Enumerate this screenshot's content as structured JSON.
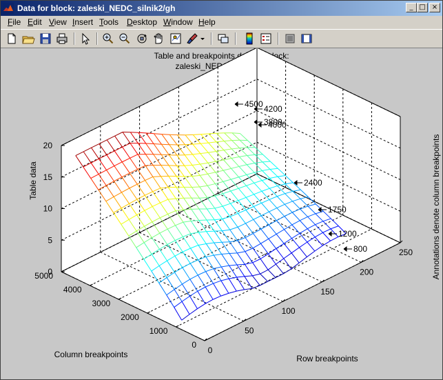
{
  "window": {
    "title": "Data for block: zaleski_NEDC_silnik2/gh",
    "colors": {
      "title_start": "#0a246a",
      "title_end": "#a6caf0",
      "figure_bg": "#c8c8c8"
    }
  },
  "window_buttons": {
    "minimize": "_",
    "maximize": "□",
    "close": "×"
  },
  "menu": [
    "File",
    "Edit",
    "View",
    "Insert",
    "Tools",
    "Desktop",
    "Window",
    "Help"
  ],
  "toolbar": {
    "icons": [
      "new-figure-icon",
      "open-file-icon",
      "save-icon",
      "print-icon",
      "edit-plot-arrow-icon",
      "zoom-in-icon",
      "zoom-out-icon",
      "rotate-3d-icon",
      "pan-icon",
      "data-cursor-icon",
      "brush-icon",
      "brush-dropdown-icon",
      "link-plot-icon",
      "colorbar-icon",
      "legend-icon",
      "hide-plot-tools-icon",
      "show-plot-tools-icon"
    ]
  },
  "plot": {
    "title_line1": "Table and breakpoints data for block:",
    "title_line2": "zaleski_NEDC_silnik2/gh",
    "right_label": "Annotations denote column breakpoints"
  },
  "chart_data": {
    "type": "surface",
    "title": "Table and breakpoints data for block: zaleski_NEDC_silnik2/gh",
    "xlabel": "Row breakpoints",
    "ylabel": "Column breakpoints",
    "zlabel": "Table data",
    "xlim": [
      0,
      250
    ],
    "ylim": [
      0,
      5000
    ],
    "zlim": [
      0,
      20
    ],
    "x_ticks": [
      "0",
      "50",
      "100",
      "150",
      "200",
      "250"
    ],
    "y_ticks": [
      "0",
      "1000",
      "2000",
      "3000",
      "4000",
      "5000"
    ],
    "z_ticks": [
      "0",
      "5",
      "10",
      "15",
      "20"
    ],
    "grid": true,
    "colormap": "jet",
    "column_breakpoint_annotations": [
      "4500",
      "4200",
      "3800",
      "4000",
      "2400",
      "1750",
      "1200",
      "800"
    ],
    "approx_surface_peak": 19.5,
    "x": [
      0,
      10,
      20,
      30,
      40,
      50,
      60,
      70,
      80,
      90,
      100,
      110,
      120,
      130,
      140,
      150,
      160,
      170,
      180,
      190,
      200,
      210
    ],
    "y": [
      800,
      1200,
      1750,
      2400,
      3800,
      4000,
      4200,
      4500
    ]
  }
}
